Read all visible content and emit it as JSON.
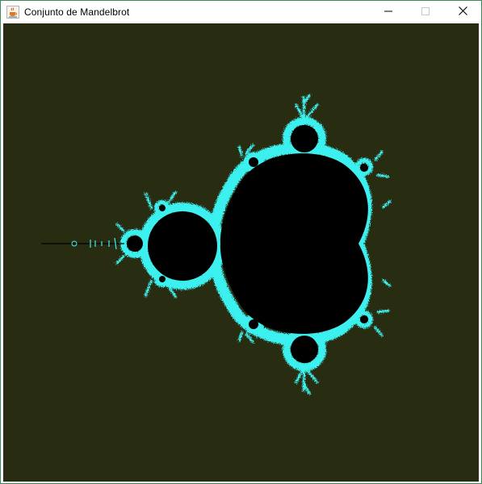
{
  "window": {
    "title": "Conjunto de Mandelbrot",
    "app_icon": "java-cup-icon",
    "controls": {
      "minimize_icon": "minimize-icon",
      "maximize_icon": "maximize-icon",
      "close_icon": "close-icon"
    }
  },
  "canvas": {
    "background_color": "#282c10",
    "set_color": "#000000",
    "boundary_color": "#3ef0f0"
  }
}
